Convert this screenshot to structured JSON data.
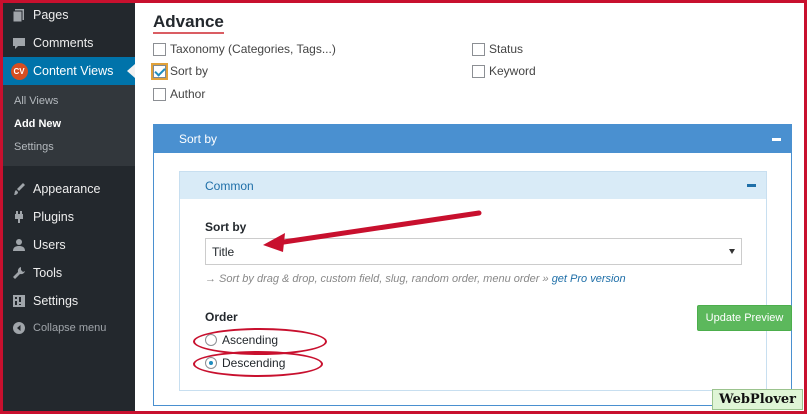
{
  "sidebar": {
    "items": [
      {
        "label": "Pages",
        "icon": "pages-icon"
      },
      {
        "label": "Comments",
        "icon": "comment-icon"
      },
      {
        "label": "Content Views",
        "icon": "cv-badge",
        "badge": "CV"
      },
      {
        "label": "Appearance",
        "icon": "paintbrush-icon"
      },
      {
        "label": "Plugins",
        "icon": "plug-icon"
      },
      {
        "label": "Users",
        "icon": "user-icon"
      },
      {
        "label": "Tools",
        "icon": "wrench-icon"
      },
      {
        "label": "Settings",
        "icon": "settings-icon"
      }
    ],
    "submenu": [
      "All Views",
      "Add New",
      "Settings"
    ],
    "collapse_label": "Collapse menu"
  },
  "main": {
    "section_title": "Advance",
    "checkboxes": [
      {
        "label": "Taxonomy (Categories, Tags...)",
        "checked": false
      },
      {
        "label": "Sort by",
        "checked": true
      },
      {
        "label": "Author",
        "checked": false
      },
      {
        "label": "Status",
        "checked": false
      },
      {
        "label": "Keyword",
        "checked": false
      }
    ],
    "panel_title": "Sort by",
    "inner_title": "Common",
    "sort_label": "Sort by",
    "sort_value": "Title",
    "hint_text": "→ Sort by drag & drop, custom field, slug, random order, menu order »",
    "hint_link": "get Pro version",
    "order_label": "Order",
    "order_options": [
      {
        "label": "Ascending",
        "selected": false
      },
      {
        "label": "Descending",
        "selected": true
      }
    ],
    "update_button": "Update Preview"
  },
  "watermark": "WebPlover",
  "colors": {
    "sidebar_bg": "#23282d",
    "active": "#0073aa",
    "panel": "#4a90d0",
    "button": "#5cb85c",
    "annotation": "#c8102e"
  }
}
